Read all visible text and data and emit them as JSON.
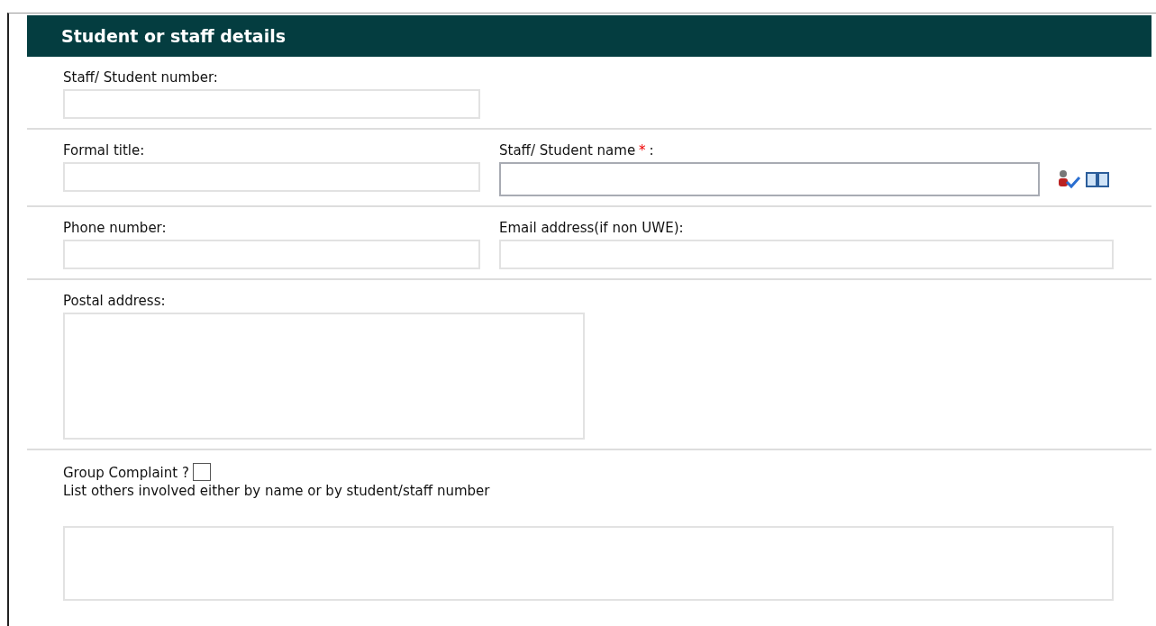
{
  "section_title": "Student or staff details",
  "staff_number": {
    "label": "Staff/ Student number:"
  },
  "formal_title": {
    "label": "Formal title:"
  },
  "staff_name": {
    "label": "Staff/ Student name",
    "required_mark": "*",
    "suffix": ":"
  },
  "phone": {
    "label": "Phone number:"
  },
  "email": {
    "label": "Email address(if non UWE):"
  },
  "postal_address": {
    "label": "Postal address:"
  },
  "group_complaint": {
    "label": "Group Complaint ?",
    "checked": false
  },
  "others": {
    "label": "List others involved either by name or by student/staff number"
  }
}
